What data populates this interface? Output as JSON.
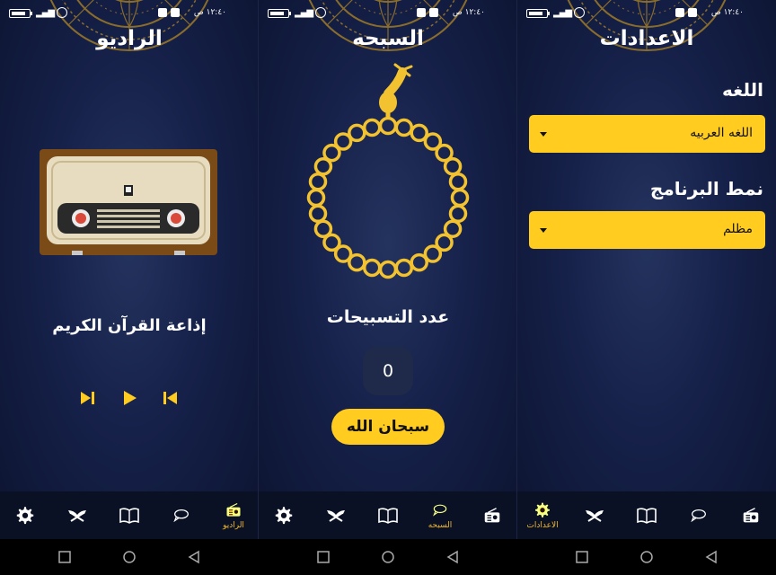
{
  "status_bar": {
    "time": "١٢:٤٠ ص"
  },
  "radio": {
    "title": "الراديو",
    "station_name": "إذاعة القرآن الكريم"
  },
  "sebha": {
    "title": "السبحه",
    "count_label": "عدد التسبيحات",
    "count_value": "0",
    "button_label": "سبحان الله"
  },
  "settings": {
    "title": "الاعدادات",
    "language_label": "اللغه",
    "language_value": "اللغه العربيه",
    "theme_label": "نمط البرنامج",
    "theme_value": "مظلم"
  },
  "nav_labels": {
    "radio": "الراديو",
    "sebha": "السبحه",
    "settings": "الاعدادات"
  },
  "icons": [
    "battery-icon",
    "signal-icon",
    "alarm-icon",
    "settings-gear-icon",
    "quran-stand-icon",
    "book-icon",
    "chat-bubble-icon",
    "radio-icon",
    "skip-next-icon",
    "play-icon",
    "skip-previous-icon",
    "square-icon",
    "circle-icon",
    "back-triangle-icon"
  ],
  "colors": {
    "accent": "#ffcc1f",
    "background": "#16214a",
    "nav_background": "#0a1124",
    "active_nav": "#f3b92a"
  }
}
